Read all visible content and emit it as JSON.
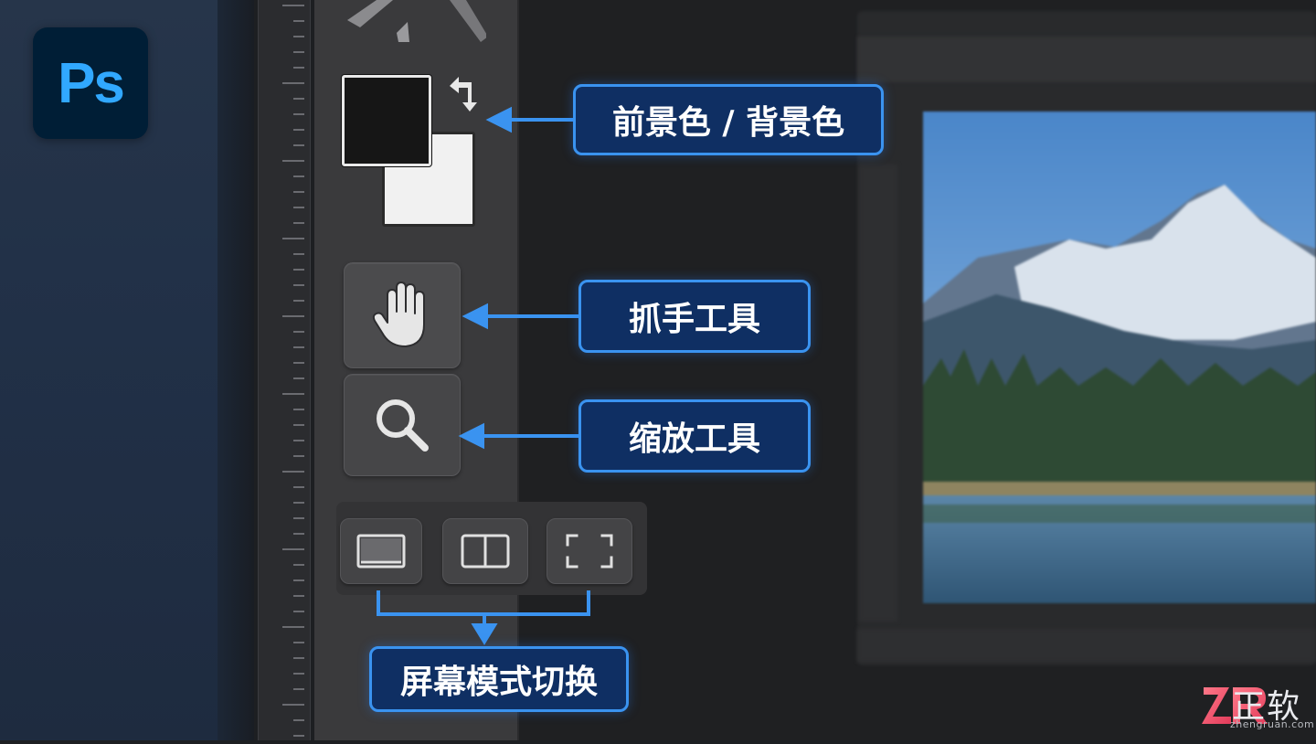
{
  "app": {
    "logo_text": "Ps"
  },
  "swatches": {
    "foreground_color": "#161616",
    "background_color": "#f1f1f1"
  },
  "tools": {
    "hand_icon": "hand-icon",
    "zoom_icon": "magnifier-icon",
    "swap_icon": "swap-colors-icon"
  },
  "screen_modes": [
    {
      "name": "standard-screen-mode",
      "icon": "monitor-icon"
    },
    {
      "name": "split-screen-mode",
      "icon": "split-icon"
    },
    {
      "name": "full-screen-mode",
      "icon": "fullscreen-corners-icon"
    }
  ],
  "callouts": {
    "color": "前景色 / 背景色",
    "hand": "抓手工具",
    "zoom": "缩放工具",
    "screen_mode": "屏幕模式切换"
  },
  "brand": {
    "mark": "ZR",
    "title": "正软",
    "url": "zhengruan.com"
  },
  "colors": {
    "accent_blue": "#3a93f0",
    "callout_fill": "#0f2f63",
    "ps_blue": "#31a8ff",
    "ps_bg": "#001e36"
  }
}
